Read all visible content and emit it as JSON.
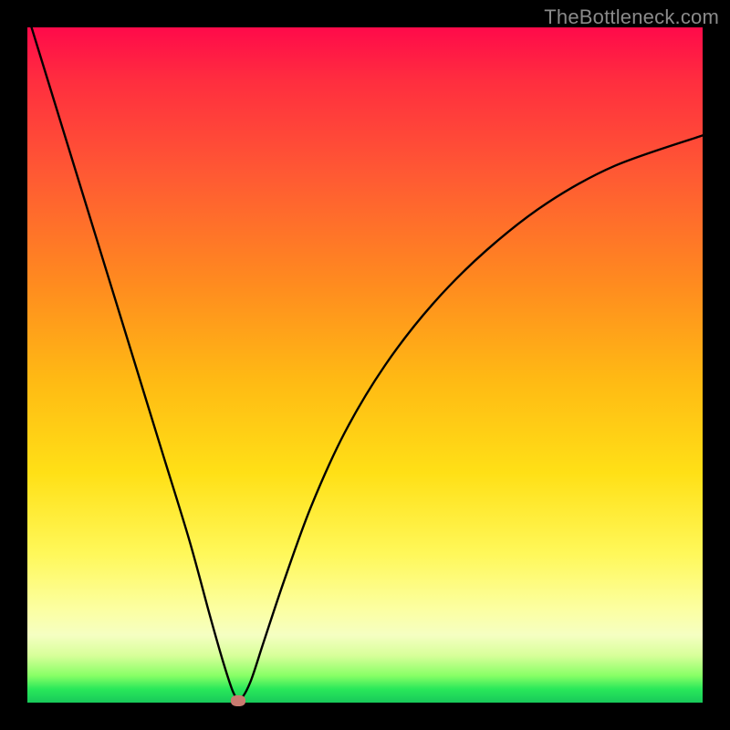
{
  "watermark": "TheBottleneck.com",
  "chart_data": {
    "type": "line",
    "title": "",
    "xlabel": "",
    "ylabel": "",
    "xlim": [
      0,
      100
    ],
    "ylim": [
      0,
      100
    ],
    "grid": false,
    "legend": false,
    "series": [
      {
        "name": "bottleneck-curve",
        "x": [
          0,
          4,
          8,
          12,
          16,
          20,
          24,
          27,
          29,
          30.5,
          31.5,
          33,
          35,
          38,
          42,
          47,
          53,
          60,
          68,
          77,
          87,
          100
        ],
        "y": [
          102,
          89,
          76,
          63,
          50,
          37,
          24,
          13,
          6,
          1.5,
          0.5,
          3,
          9,
          18,
          29,
          40,
          50,
          59,
          67,
          74,
          79.5,
          84
        ]
      }
    ],
    "marker": {
      "x": 31.2,
      "y": 0.3
    },
    "background_gradient": {
      "stops": [
        {
          "pos": 0,
          "color": "#ff0a4a"
        },
        {
          "pos": 38,
          "color": "#ff8b1f"
        },
        {
          "pos": 66,
          "color": "#ffe016"
        },
        {
          "pos": 90,
          "color": "#f5ffc2"
        },
        {
          "pos": 100,
          "color": "#18c95a"
        }
      ]
    }
  }
}
